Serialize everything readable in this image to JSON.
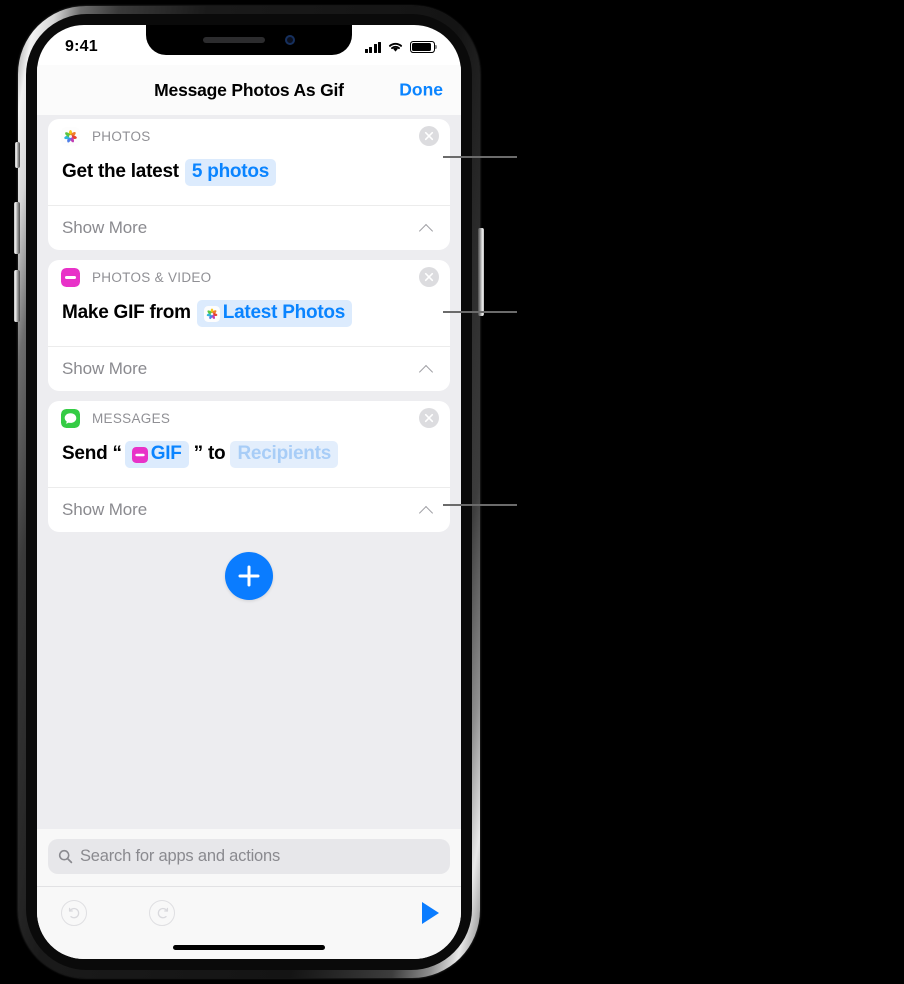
{
  "status_bar": {
    "time": "9:41",
    "signal_icon": "cellular-signal-icon",
    "wifi_icon": "wifi-icon",
    "battery_icon": "battery-icon"
  },
  "nav_bar": {
    "title": "Message Photos As Gif",
    "done_label": "Done"
  },
  "cards": [
    {
      "category": "PHOTOS",
      "app_icon": "photos-app-icon",
      "close_icon": "close-circle-icon",
      "action_prefix": "Get the latest",
      "action_suffix": "",
      "token": {
        "label": "5 photos",
        "type": "value",
        "icon": ""
      },
      "show_more_label": "Show More",
      "chevron_icon": "chevron-up-icon"
    },
    {
      "category": "PHOTOS & VIDEO",
      "app_icon": "gif-app-icon",
      "close_icon": "close-circle-icon",
      "action_prefix": "Make GIF from",
      "action_suffix": "",
      "token": {
        "label": "Latest Photos",
        "type": "variable",
        "icon": "photos-app-icon"
      },
      "show_more_label": "Show More",
      "chevron_icon": "chevron-up-icon"
    },
    {
      "category": "MESSAGES",
      "app_icon": "messages-app-icon",
      "close_icon": "close-circle-icon",
      "action_prefix": "Send “",
      "action_middle": " ” to ",
      "token": {
        "label": "GIF",
        "type": "variable",
        "icon": "gif-app-icon"
      },
      "token2": {
        "label": "Recipients",
        "type": "placeholder",
        "icon": ""
      },
      "show_more_label": "Show More",
      "chevron_icon": "chevron-up-icon"
    }
  ],
  "add_button": {
    "icon": "plus-icon",
    "label": "+"
  },
  "search": {
    "placeholder": "Search for apps and actions",
    "icon": "search-icon",
    "value": ""
  },
  "toolbar": {
    "undo_icon": "undo-icon",
    "redo_icon": "redo-icon",
    "play_icon": "play-icon"
  },
  "colors": {
    "accent_blue": "#0a7cff",
    "link_blue": "#0a84ff",
    "token_bg": "#dcebfd",
    "placeholder_blue": "#a8cdf7",
    "background_gray": "#ededf0",
    "category_gray": "#909095",
    "messages_green": "#35cc45",
    "gif_magenta": "#e832c8"
  }
}
